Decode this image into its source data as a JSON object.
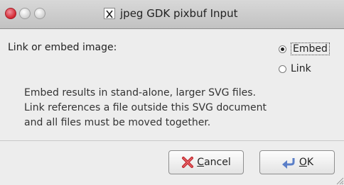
{
  "window": {
    "title": "jpeg GDK pixbuf Input",
    "controls": [
      "close",
      "minimize",
      "maximize"
    ]
  },
  "dialog": {
    "prompt": "Link or embed image:",
    "options": [
      {
        "label": "Embed",
        "selected": true
      },
      {
        "label": "Link",
        "selected": false
      }
    ],
    "description_lines": [
      "Embed results in stand-alone, larger SVG files.",
      "Link references a file outside this SVG document",
      "and all files must be moved together."
    ]
  },
  "buttons": {
    "cancel_first": "C",
    "cancel_rest": "ancel",
    "ok_first": "O",
    "ok_rest": "K"
  },
  "icons": {
    "cancel": "red-x-icon",
    "ok": "back-arrow-icon"
  },
  "colors": {
    "close_button": "#d3252f",
    "cancel_icon": "#c0282d",
    "ok_icon": "#5b7fc8"
  }
}
